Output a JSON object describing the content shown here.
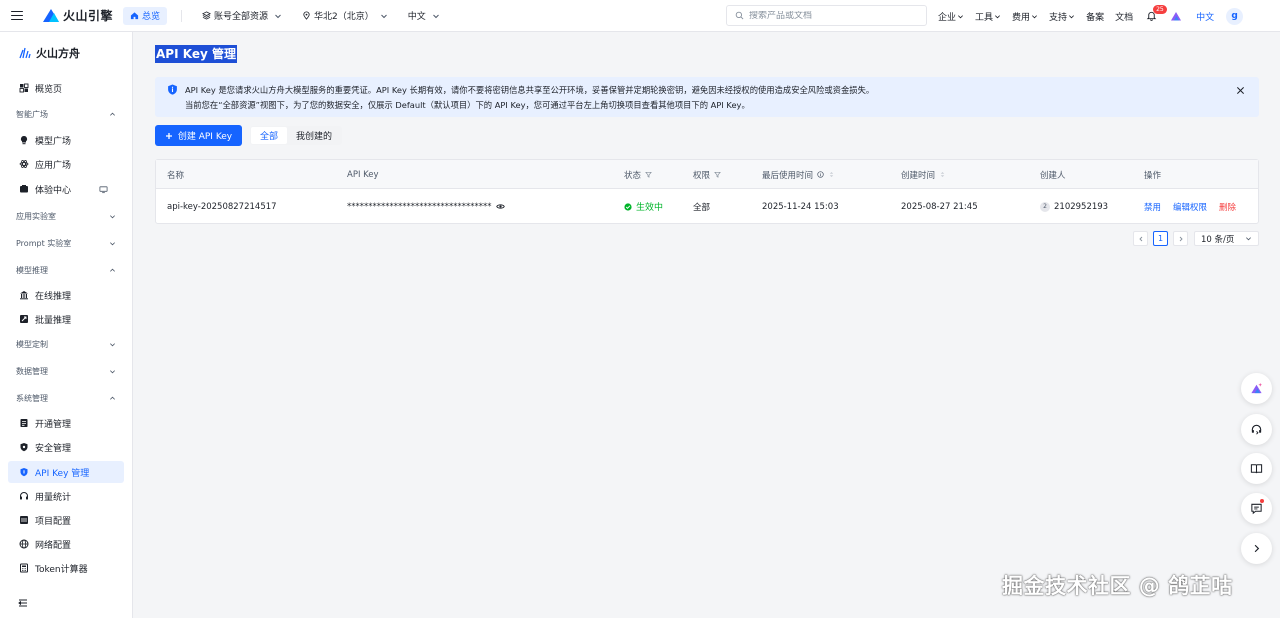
{
  "topbar": {
    "brand": "火山引擎",
    "home_label": "总览",
    "resource_select": "账号全部资源",
    "region_select": "华北2（北京）",
    "language_select": "中文",
    "search_placeholder": "搜索产品或文档",
    "menu": [
      {
        "label": "企业"
      },
      {
        "label": "工具"
      },
      {
        "label": "费用"
      },
      {
        "label": "支持"
      }
    ],
    "filing": "备案",
    "docs": "文档",
    "notification_count": "25",
    "lang_link": "中文",
    "avatar_letter": "g"
  },
  "sidebar": {
    "brand": "火山方舟",
    "overview": "概览页",
    "groups": {
      "smart_square": "智能广场",
      "app_lab": "应用实验室",
      "prompt_lab": "Prompt 实验室",
      "inference": "模型推理",
      "customization": "模型定制",
      "data": "数据管理",
      "system": "系统管理"
    },
    "items": {
      "model_square": "模型广场",
      "app_square": "应用广场",
      "experience": "体验中心",
      "online_inference": "在线推理",
      "batch_inference": "批量推理",
      "activation": "开通管理",
      "security": "安全管理",
      "api_key": "API Key 管理",
      "usage": "用量统计",
      "project": "项目配置",
      "network": "网络配置",
      "token_calc": "Token计算器"
    }
  },
  "main": {
    "title": "API Key 管理",
    "alert_line1": "API Key 是您请求火山方舟大模型服务的重要凭证。API Key 长期有效，请你不要将密钥信息共享至公开环境，妥善保管并定期轮换密钥，避免因未经授权的使用造成安全风险或资金损失。",
    "alert_line2": "当前您在“全部资源”视图下，为了您的数据安全，仅展示 Default（默认项目）下的 API Key，您可通过平台左上角切换项目查看其他项目下的 API Key。",
    "create_button": "创建 API Key",
    "tabs": {
      "all": "全部",
      "mine": "我创建的"
    },
    "columns": {
      "name": "名称",
      "api_key": "API Key",
      "status": "状态",
      "permission": "权限",
      "last_used": "最后使用时间",
      "created_at": "创建时间",
      "creator": "创建人",
      "actions": "操作"
    },
    "row": {
      "name": "api-key-20250827214517",
      "api_key": "**********************************",
      "status": "生效中",
      "permission": "全部",
      "last_used": "2025-11-24 15:03",
      "created_at": "2025-08-27 21:45",
      "creator_badge": "2",
      "creator": "2102952193",
      "action_disable": "禁用",
      "action_edit": "编辑权限",
      "action_delete": "删除"
    },
    "pagination": {
      "current_page": "1",
      "page_size": "10 条/页"
    }
  },
  "watermark": "掘金技术社区 @ 鸽芷咕",
  "colors": {
    "primary": "#1664ff",
    "success": "#00b42a",
    "danger": "#f53f3f",
    "alert_bg": "#e8f0ff"
  }
}
